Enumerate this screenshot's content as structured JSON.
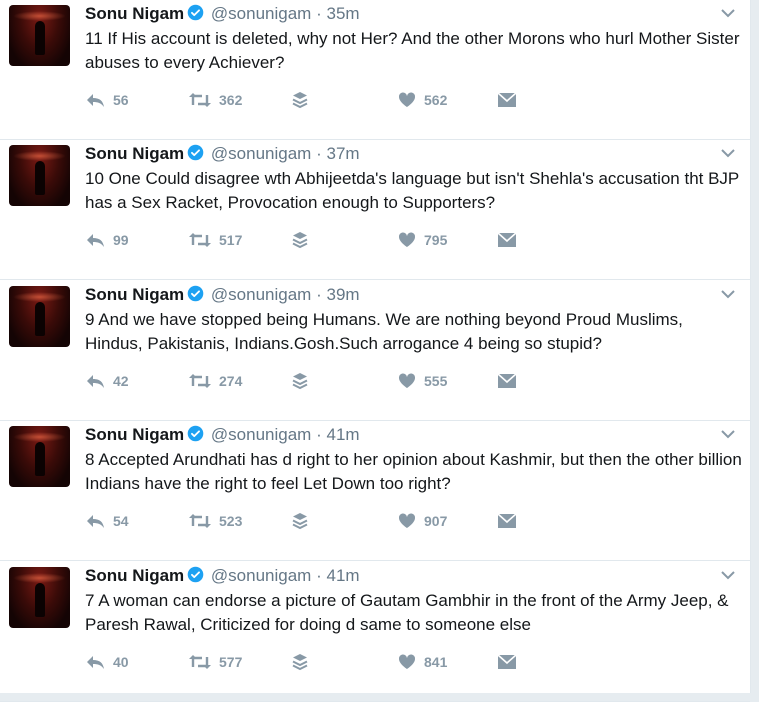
{
  "tweets": [
    {
      "name": "Sonu Nigam",
      "handle": "@sonunigam",
      "dot": "·",
      "time": "35m",
      "text": "11 If His account is deleted, why not Her? And the other Morons who hurl Mother Sister abuses to every Achiever?",
      "replies": "56",
      "retweets": "362",
      "likes": "562"
    },
    {
      "name": "Sonu Nigam",
      "handle": "@sonunigam",
      "dot": "·",
      "time": "37m",
      "text": "10 One Could disagree wth Abhijeetda's language but isn't Shehla's accusation tht BJP has a Sex Racket, Provocation enough to Supporters?",
      "replies": "99",
      "retweets": "517",
      "likes": "795"
    },
    {
      "name": "Sonu Nigam",
      "handle": "@sonunigam",
      "dot": "·",
      "time": "39m",
      "text": "9 And we have stopped being Humans. We are nothing beyond Proud Muslims, Hindus, Pakistanis, Indians.Gosh.Such arrogance 4 being so stupid?",
      "replies": "42",
      "retweets": "274",
      "likes": "555"
    },
    {
      "name": "Sonu Nigam",
      "handle": "@sonunigam",
      "dot": "·",
      "time": "41m",
      "text": "8 Accepted Arundhati has d right to her opinion about Kashmir, but then the other billion Indians have the right to feel Let Down too right?",
      "replies": "54",
      "retweets": "523",
      "likes": "907"
    },
    {
      "name": "Sonu Nigam",
      "handle": "@sonunigam",
      "dot": "·",
      "time": "41m",
      "text": "7 A woman can endorse a picture of Gautam Gambhir in the front of the Army Jeep, & Paresh Rawal, Criticized for doing d same to someone else",
      "replies": "40",
      "retweets": "577",
      "likes": "841"
    }
  ],
  "icons": {
    "verified": "verified-badge-icon",
    "caret": "chevron-down-icon",
    "reply": "reply-icon",
    "retweet": "retweet-icon",
    "stack": "stack-icon",
    "like": "heart-icon",
    "dm": "direct-message-icon"
  },
  "colors": {
    "verified_blue": "#1da1f2",
    "action_grey": "#8899a6",
    "text": "#14171a",
    "meta": "#657786"
  }
}
